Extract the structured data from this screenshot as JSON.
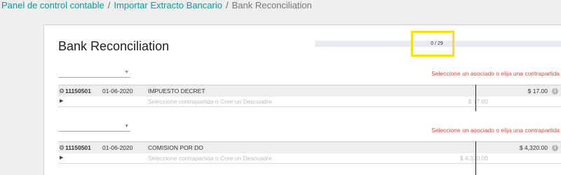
{
  "breadcrumb": {
    "items": [
      "Panel de control contable",
      "Importar Extracto Bancario"
    ],
    "current": "Bank Reconciliation",
    "separator": "/"
  },
  "page_title": "Bank Reconciliation",
  "progress": {
    "label": "0 / 29",
    "done": 0,
    "total": 29
  },
  "lines": [
    {
      "select_value": "",
      "hint": "Seleccione un asociado o elija una contrapartida",
      "reference": "11150501",
      "date": "01-06-2020",
      "label": "IMPUESTO DECRET",
      "amount": "$ 17.00",
      "counterpart_placeholder": "Seleccione contrapartida o Cree un Descuadre",
      "counterpart_amount": "$ 17.00"
    },
    {
      "select_value": "",
      "hint": "Seleccione un asociado o elija una contrapartida",
      "reference": "11150501",
      "date": "01-06-2020",
      "label": "COMISION POR DO",
      "amount": "$ 4,320.00",
      "counterpart_placeholder": "Seleccione contrapartida o Cree un Descuadre",
      "counterpart_amount": "$ 4,320.00"
    }
  ],
  "icons": {
    "gear": "gear-icon",
    "expand": "caret-right-icon",
    "info": "info-icon",
    "select_caret": "caret-down-icon"
  },
  "colors": {
    "link": "#00a09d",
    "hint": "#e24a3b",
    "highlight": "#ffe200",
    "row_bg": "#eeeeee",
    "progress_track": "#e8ebef"
  }
}
